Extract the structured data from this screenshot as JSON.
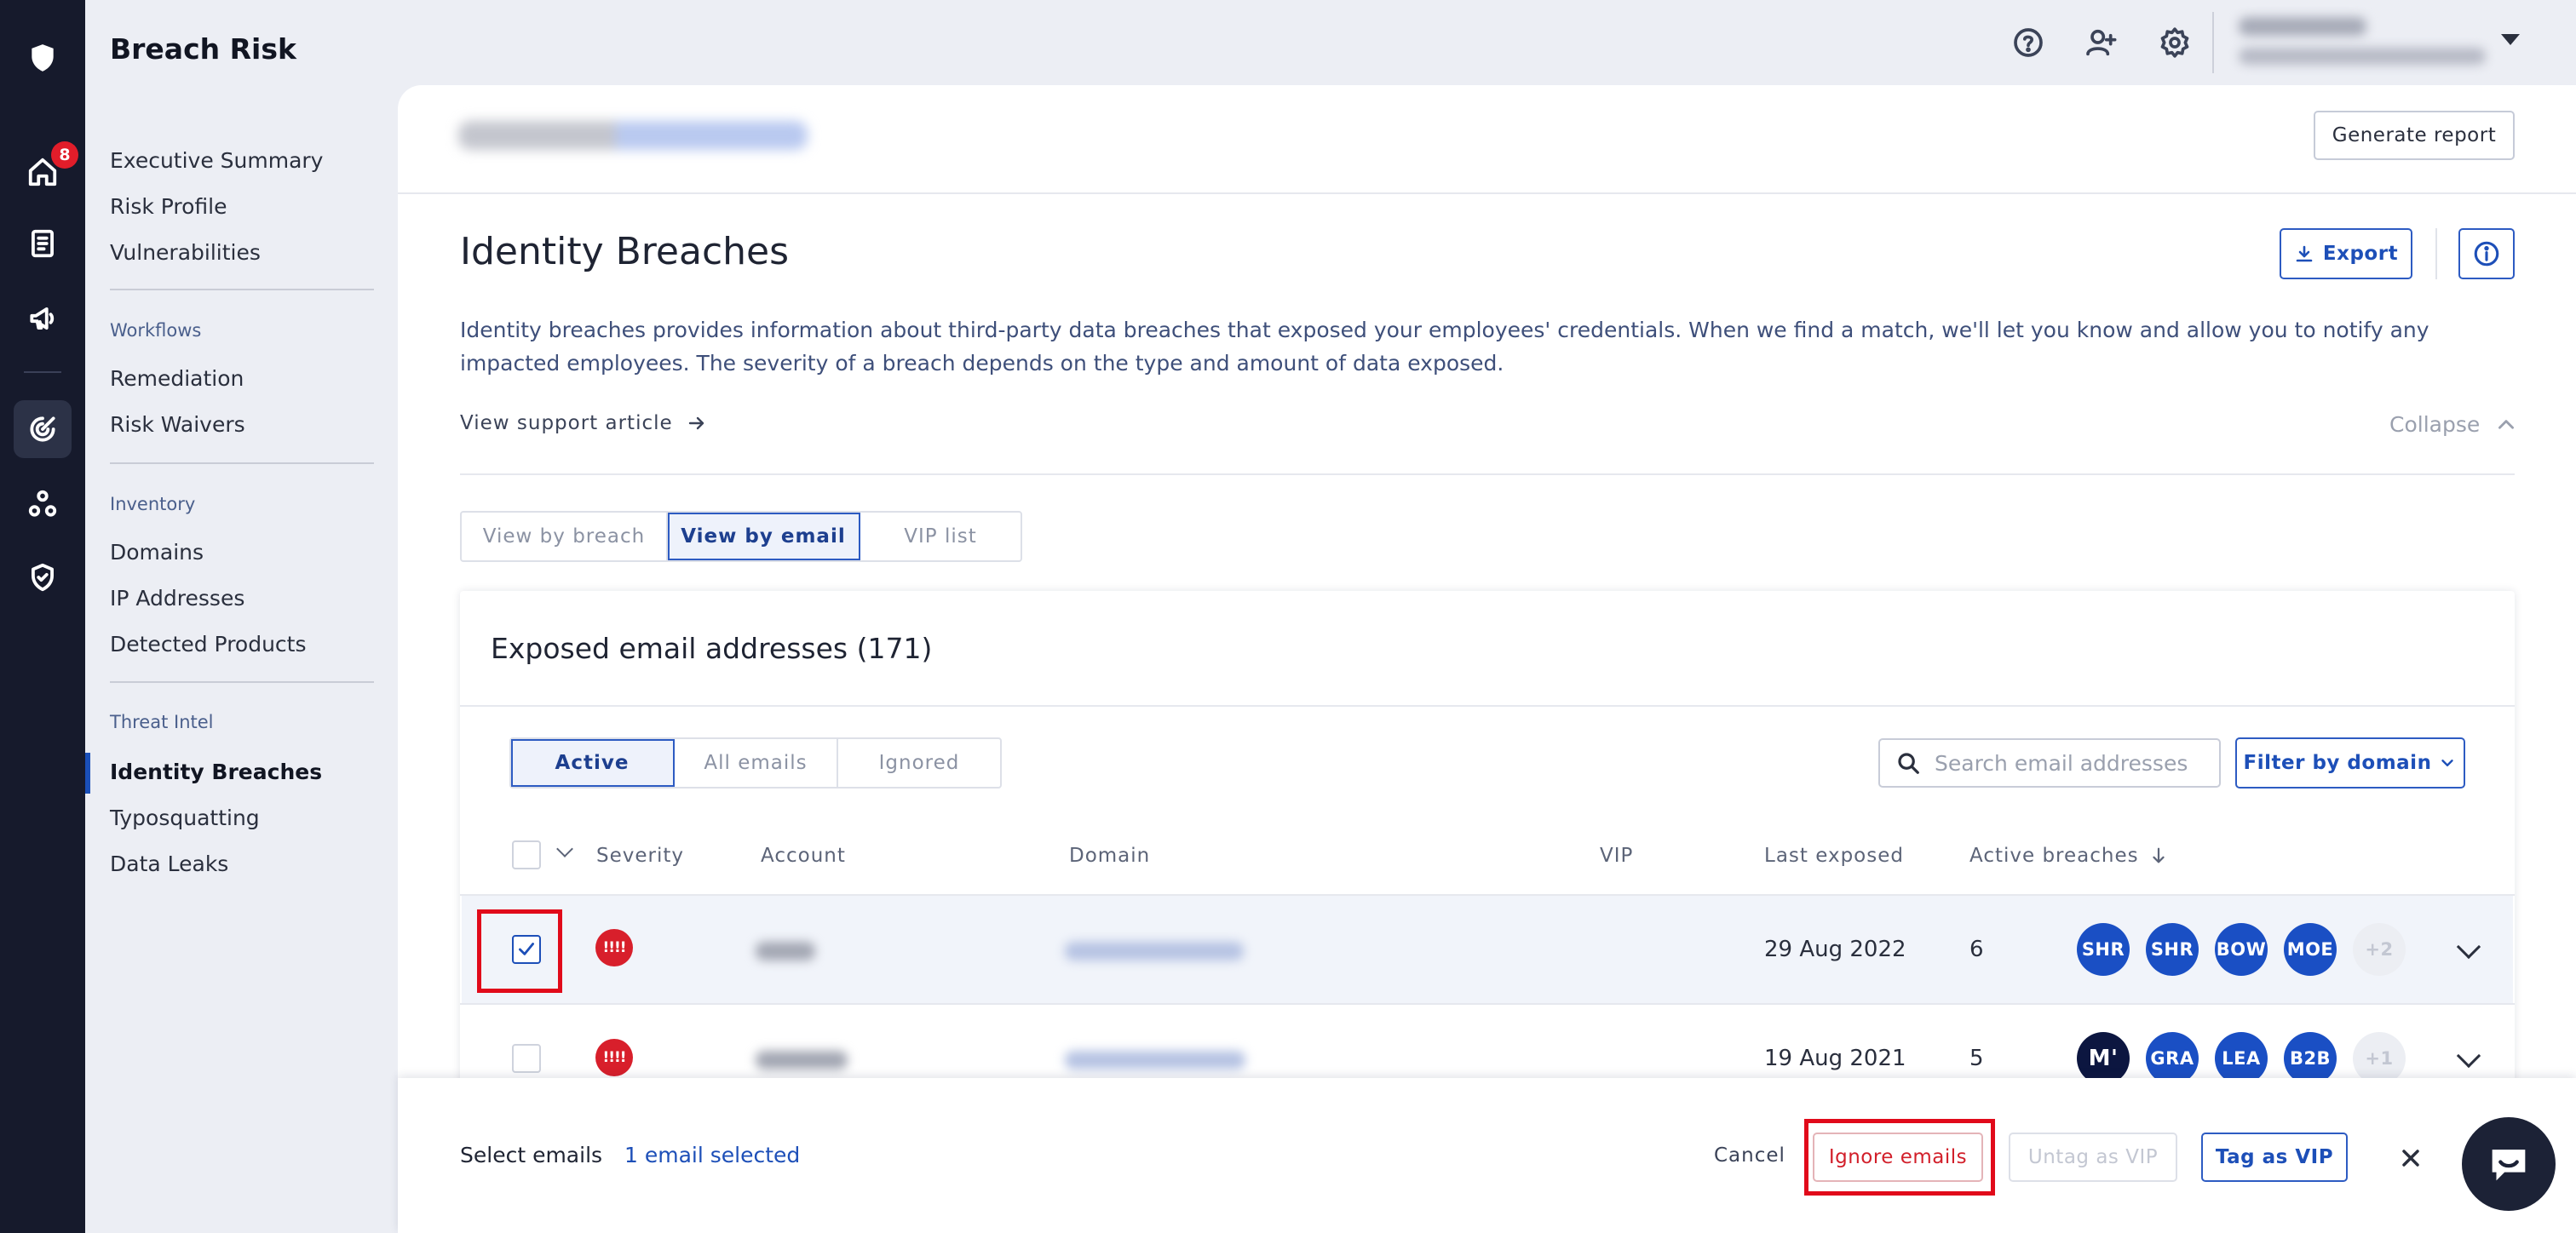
{
  "app": {
    "title": "Breach Risk"
  },
  "rail": {
    "notification_count": "8"
  },
  "nav": {
    "items_top": [
      "Executive Summary",
      "Risk Profile",
      "Vulnerabilities"
    ],
    "workflows": {
      "label": "Workflows",
      "items": [
        "Remediation",
        "Risk Waivers"
      ]
    },
    "inventory": {
      "label": "Inventory",
      "items": [
        "Domains",
        "IP Addresses",
        "Detected Products"
      ]
    },
    "threat_intel": {
      "label": "Threat Intel",
      "items": [
        "Identity Breaches",
        "Typosquatting",
        "Data Leaks"
      ]
    }
  },
  "header": {
    "generate_report": "Generate report"
  },
  "page": {
    "title": "Identity Breaches",
    "export": "Export",
    "description": "Identity breaches provides information about third-party data breaches that exposed your employees' credentials. When we find a match, we'll let you know and allow you to notify any impacted employees. The severity of a breach depends on the type and amount of data exposed.",
    "support_link": "View support article",
    "collapse": "Collapse"
  },
  "views": {
    "by_breach": "View by breach",
    "by_email": "View by email",
    "vip": "VIP list"
  },
  "card": {
    "title": "Exposed email addresses (171)",
    "filters": {
      "active": "Active",
      "all": "All emails",
      "ignored": "Ignored"
    },
    "search_placeholder": "Search email addresses",
    "filter_domain": "Filter by domain",
    "columns": {
      "severity": "Severity",
      "account": "Account",
      "domain": "Domain",
      "vip": "VIP",
      "last_exposed": "Last exposed",
      "active_breaches": "Active breaches"
    },
    "rows": [
      {
        "severity": "!!!!",
        "last_exposed": "29 Aug 2022",
        "active_breaches": "6",
        "chips": [
          "SHR",
          "SHR",
          "BOW",
          "MOE"
        ],
        "more": "+2"
      },
      {
        "severity": "!!!!",
        "last_exposed": "19 Aug 2021",
        "active_breaches": "5",
        "chips": [
          "M'",
          "GRA",
          "LEA",
          "B2B"
        ],
        "more": "+1"
      }
    ]
  },
  "actionbar": {
    "select_label": "Select emails",
    "selected_count": "1 email selected",
    "cancel": "Cancel",
    "ignore": "Ignore emails",
    "untag": "Untag as VIP",
    "tag": "Tag as VIP"
  },
  "colors": {
    "accent": "#1d4fb8",
    "danger": "#d81f2b",
    "rail": "#161a2c",
    "highlight": "#e10a1a"
  }
}
